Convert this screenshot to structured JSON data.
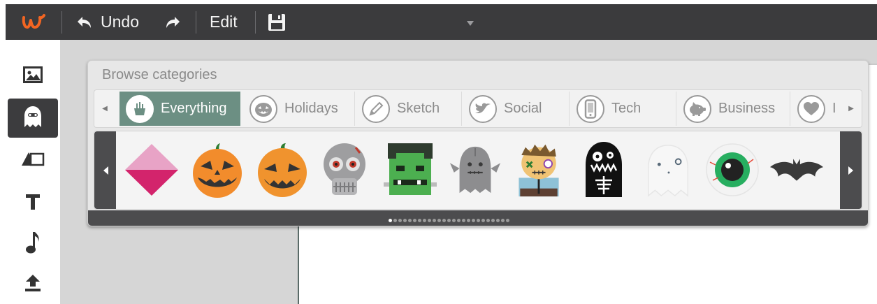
{
  "toolbar": {
    "logo": "w",
    "undo_label": "Undo",
    "edit_label": "Edit",
    "icons": {
      "undo": "undo-arrow-icon",
      "redo": "redo-arrow-icon",
      "save": "floppy-disk-icon",
      "more": "caret-down-icon"
    }
  },
  "sidebar": {
    "items": [
      {
        "name": "image-tool",
        "icon": "image-icon"
      },
      {
        "name": "sticker-tool",
        "icon": "ghost-icon",
        "active": true
      },
      {
        "name": "shape-tool",
        "icon": "shapes-icon"
      },
      {
        "name": "text-tool",
        "icon": "text-icon"
      },
      {
        "name": "music-tool",
        "icon": "music-note-icon"
      },
      {
        "name": "upload-tool",
        "icon": "upload-icon"
      }
    ]
  },
  "panel": {
    "title": "Browse categories",
    "categories": [
      {
        "label": "Everything",
        "icon": "basket-icon",
        "active": true
      },
      {
        "label": "Holidays",
        "icon": "pumpkin-icon"
      },
      {
        "label": "Sketch",
        "icon": "pencil-icon"
      },
      {
        "label": "Social",
        "icon": "bird-icon"
      },
      {
        "label": "Tech",
        "icon": "phone-icon"
      },
      {
        "label": "Business",
        "icon": "piggy-bank-icon"
      },
      {
        "label": "I",
        "icon": "heart-icon"
      }
    ],
    "stickers": [
      "pink-diamond",
      "jack-o-lantern",
      "jack-o-lantern-small",
      "zombie-skull",
      "frankenstein",
      "gray-ghost-monster",
      "stitched-zombie",
      "skeleton-monster",
      "white-ghost",
      "eyeball",
      "bat"
    ],
    "pages": {
      "total": 25,
      "current": 1
    }
  },
  "colors": {
    "topbar": "#3b3b3d",
    "accent": "#6c8f83",
    "logo": "#f26522",
    "pumpkin": "#f28c2c",
    "diamond": "#d3246c"
  }
}
